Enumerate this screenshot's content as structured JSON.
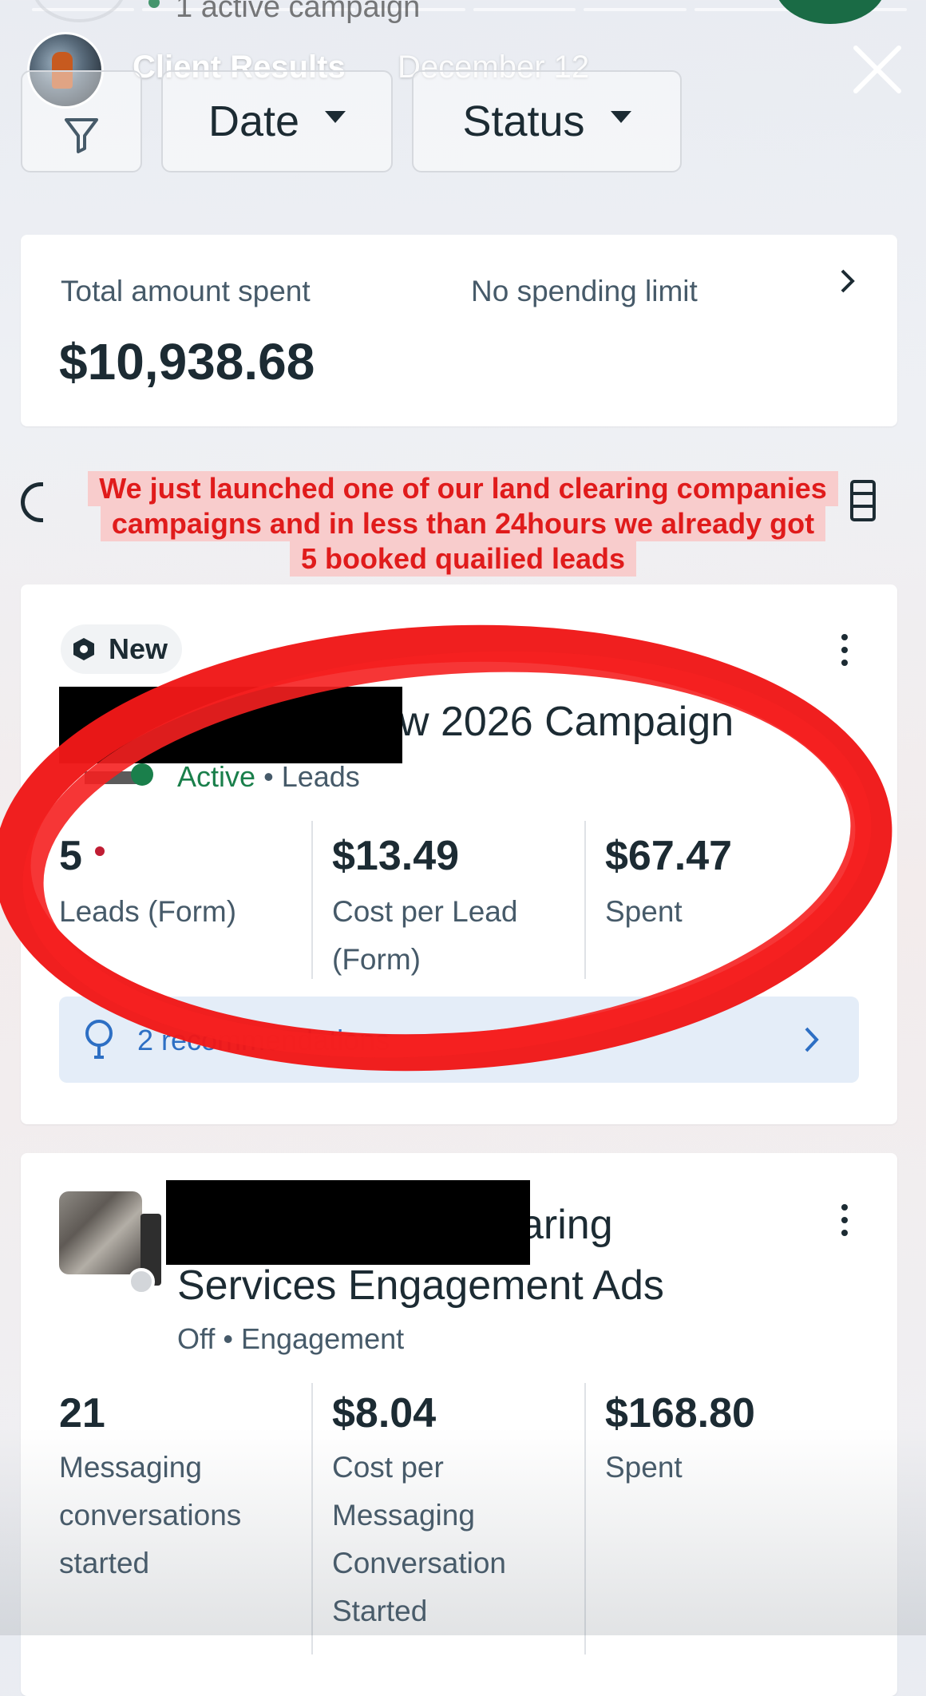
{
  "story": {
    "author": "Client Results",
    "date": "December 12",
    "progress_segments": 8
  },
  "behind": {
    "campaign_count": "1 active campaign"
  },
  "filters": {
    "date_label": "Date",
    "status_label": "Status"
  },
  "summary": {
    "spent_label": "Total amount spent",
    "spent_value": "$10,938.68",
    "limit_label": "No spending limit"
  },
  "annotation": {
    "lines": [
      "We just launched one of our land clearing companies",
      "campaigns and in less than 24hours we already got",
      "5 booked quailied leads"
    ],
    "color": "#e01b1b"
  },
  "campaign1": {
    "badge": "New",
    "title_visible": "w 2026 Campaign",
    "status": "Active",
    "objective": "Leads",
    "metrics": [
      {
        "value": "5",
        "label": "Leads (Form)"
      },
      {
        "value": "$13.49",
        "label": "Cost per Lead (Form)"
      },
      {
        "value": "$67.47",
        "label": "Spent"
      }
    ],
    "recommendations": "2 recommendations"
  },
  "campaign2": {
    "title_line1_visible": "aring",
    "title_line2": "Services Engagement Ads",
    "status": "Off",
    "objective": "Engagement",
    "metrics": [
      {
        "value": "21",
        "label": "Messaging conversations started"
      },
      {
        "value": "$8.04",
        "label": "Cost per Messaging Conversation Started"
      },
      {
        "value": "$168.80",
        "label": "Spent"
      }
    ]
  },
  "separator": "•",
  "colors": {
    "active_green": "#1a7f4b",
    "link_blue": "#2d6fc4",
    "text_primary": "#1c2b33",
    "text_secondary": "#465a69",
    "highlight_red": "#e01b1b"
  },
  "icons": [
    "filter-icon",
    "close-icon",
    "caret-down-icon",
    "chevron-right-icon",
    "lightbulb-icon",
    "more-vert-icon",
    "new-badge-icon"
  ]
}
